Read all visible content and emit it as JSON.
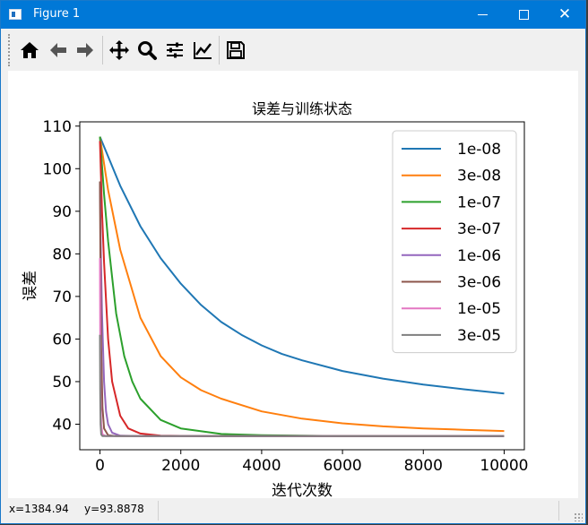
{
  "window": {
    "title": "Figure 1",
    "minimize_icon": "minimize-icon",
    "maximize_icon": "maximize-icon",
    "close_icon": "close-icon"
  },
  "toolbar": {
    "tools": [
      "home-icon",
      "back-arrow-icon",
      "forward-arrow-icon",
      "pan-move-icon",
      "zoom-magnifier-icon",
      "configure-subplots-icon",
      "edit-axis-icon",
      "save-floppy-icon"
    ]
  },
  "status": {
    "x_readout": "x=1384.94",
    "y_readout": "y=93.8878"
  },
  "chart_data": {
    "type": "line",
    "title": "误差与训练状态",
    "xlabel": "迭代次数",
    "ylabel": "误差",
    "xlim": [
      -500,
      10500
    ],
    "ylim": [
      34,
      111
    ],
    "xticks": [
      0,
      2000,
      4000,
      6000,
      8000,
      10000
    ],
    "yticks": [
      40,
      50,
      60,
      70,
      80,
      90,
      100,
      110
    ],
    "legend_position": "top-right",
    "grid": false,
    "series": [
      {
        "name": "1e-08",
        "color": "#1f77b4",
        "x": [
          0,
          500,
          1000,
          1500,
          2000,
          2500,
          3000,
          3500,
          4000,
          4500,
          5000,
          6000,
          7000,
          8000,
          9000,
          10000
        ],
        "y": [
          107.5,
          96,
          86.5,
          79,
          73,
          68,
          64,
          61,
          58.5,
          56.5,
          55,
          52.5,
          50.7,
          49.3,
          48.2,
          47.2
        ]
      },
      {
        "name": "3e-08",
        "color": "#ff7f0e",
        "x": [
          0,
          200,
          500,
          1000,
          1500,
          2000,
          2500,
          3000,
          4000,
          5000,
          6000,
          7000,
          8000,
          9000,
          10000
        ],
        "y": [
          107.5,
          95,
          81,
          65,
          56,
          51,
          48,
          46,
          43,
          41.3,
          40.2,
          39.5,
          39,
          38.7,
          38.4
        ]
      },
      {
        "name": "1e-07",
        "color": "#2ca02c",
        "x": [
          0,
          100,
          200,
          400,
          600,
          800,
          1000,
          1500,
          2000,
          3000,
          4000,
          6000,
          10000
        ],
        "y": [
          107.5,
          94,
          83,
          66,
          56,
          50,
          46,
          41,
          39,
          37.7,
          37.4,
          37.2,
          37.2
        ]
      },
      {
        "name": "3e-07",
        "color": "#d62728",
        "x": [
          0,
          50,
          100,
          200,
          300,
          500,
          700,
          1000,
          1500,
          2500,
          10000
        ],
        "y": [
          106.5,
          90,
          78,
          60,
          50,
          42,
          39,
          37.8,
          37.3,
          37.2,
          37.2
        ]
      },
      {
        "name": "1e-06",
        "color": "#9467bd",
        "x": [
          0,
          20,
          50,
          100,
          150,
          200,
          300,
          500,
          1000,
          10000
        ],
        "y": [
          97,
          82,
          66,
          50,
          43,
          40,
          38,
          37.3,
          37.2,
          37.2
        ]
      },
      {
        "name": "3e-06",
        "color": "#8c564b",
        "x": [
          0,
          10,
          30,
          60,
          100,
          200,
          400,
          10000
        ],
        "y": [
          97,
          80,
          58,
          44,
          39,
          37.4,
          37.2,
          37.2
        ]
      },
      {
        "name": "1e-05",
        "color": "#e377c2",
        "x": [
          0,
          5,
          15,
          30,
          60,
          150,
          10000
        ],
        "y": [
          79,
          62,
          46,
          40,
          37.6,
          37.2,
          37.2
        ]
      },
      {
        "name": "3e-05",
        "color": "#7f7f7f",
        "x": [
          0,
          5,
          15,
          30,
          60,
          10000
        ],
        "y": [
          61,
          48,
          40,
          37.6,
          37.2,
          37.2
        ]
      }
    ]
  }
}
